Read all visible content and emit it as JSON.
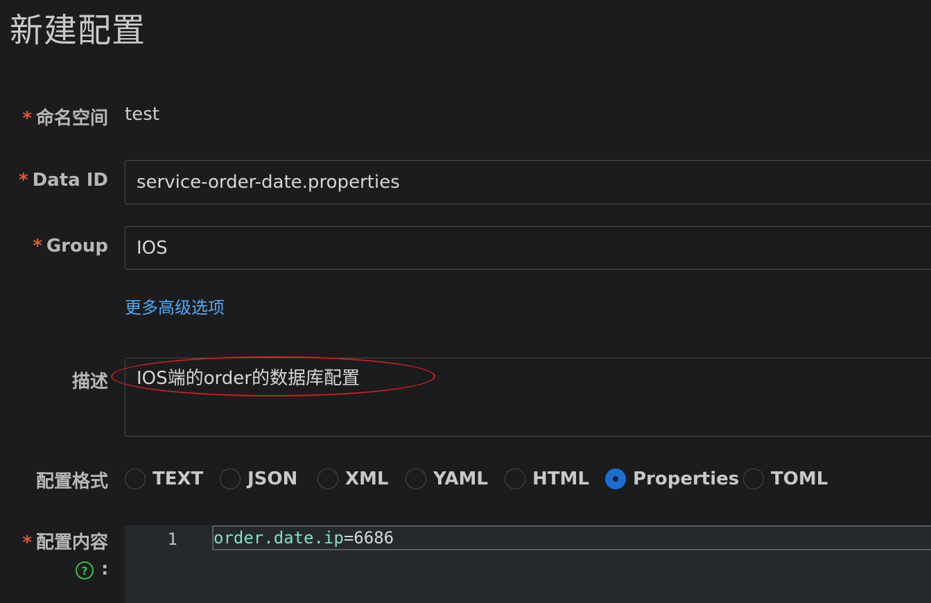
{
  "page": {
    "title": "新建配置"
  },
  "form": {
    "namespace": {
      "label": "命名空间",
      "required_mark": "*",
      "value": "test"
    },
    "data_id": {
      "label": "Data ID",
      "required_mark": "*",
      "value": "service-order-date.properties"
    },
    "group": {
      "label": "Group",
      "required_mark": "*",
      "value": "IOS"
    },
    "advanced_link": "更多高级选项",
    "description": {
      "label": "描述",
      "value": "IOS端的order的数据库配置"
    },
    "format": {
      "label": "配置格式",
      "options": [
        "TEXT",
        "JSON",
        "XML",
        "YAML",
        "HTML",
        "Properties",
        "TOML"
      ],
      "selected": "Properties"
    },
    "content": {
      "label": "配置内容",
      "required_mark": "*",
      "colon": ":",
      "help_icon": "question-circle-icon",
      "help_symbol": "?",
      "lines": [
        {
          "number": "1",
          "key": "order.date.ip",
          "operator": "=",
          "value": "6686"
        }
      ]
    }
  },
  "colors": {
    "required": "#e5533d",
    "link": "#53a8f3",
    "radio_checked": "#1a6fd6",
    "annotation": "#d31d1f",
    "help_icon": "#3cbe4b"
  }
}
